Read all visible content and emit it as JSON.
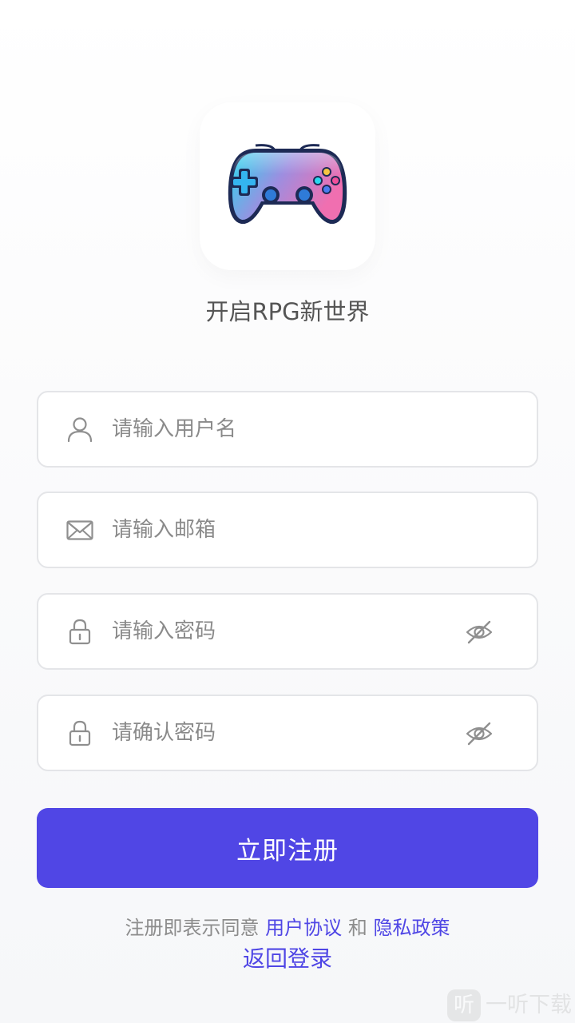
{
  "app": {
    "logo_icon": "gamepad-icon",
    "tagline": "开启RPG新世界"
  },
  "form": {
    "username": {
      "placeholder": "请输入用户名",
      "value": "",
      "icon": "user-icon"
    },
    "email": {
      "placeholder": "请输入邮箱",
      "value": "",
      "icon": "mail-icon"
    },
    "password": {
      "placeholder": "请输入密码",
      "value": "",
      "icon": "lock-icon",
      "toggle_icon": "eye-off-icon"
    },
    "confirm_password": {
      "placeholder": "请确认密码",
      "value": "",
      "icon": "lock-icon",
      "toggle_icon": "eye-off-icon"
    }
  },
  "register_button": {
    "label": "立即注册"
  },
  "terms": {
    "prefix": "注册即表示同意",
    "user_agreement": "用户协议",
    "conjunction": "和",
    "privacy_policy": "隐私政策"
  },
  "back_to_login": "返回登录",
  "watermark": {
    "icon_glyph": "听",
    "text": "一听下载"
  },
  "colors": {
    "primary": "#5046e5",
    "link": "#4f46e5",
    "border": "#e4e5e8",
    "placeholder": "#8a8a8a"
  }
}
